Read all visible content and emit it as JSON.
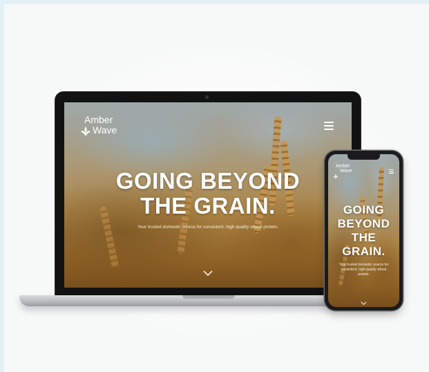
{
  "brand": {
    "line1": "Amber",
    "line2": "Wave",
    "logo_icon": "wheat-leaves-icon"
  },
  "hero": {
    "headline_line1": "GOING BEYOND",
    "headline_line2": "THE GRAIN.",
    "subline": "Your trusted domestic source for consistent, high-quality wheat protein."
  },
  "mobile": {
    "headline_lines": [
      "GOING",
      "BEYOND",
      "THE",
      "GRAIN."
    ],
    "subline": "Your trusted domestic source for consistent, high-quality wheat protein."
  },
  "icons": {
    "menu": "hamburger-menu-icon",
    "scroll": "chevron-down-icon"
  },
  "colors": {
    "background": "#e3f0f5",
    "text": "#ffffff",
    "laptop_frame": "#121212",
    "aluminum": "#bfc1c4"
  }
}
